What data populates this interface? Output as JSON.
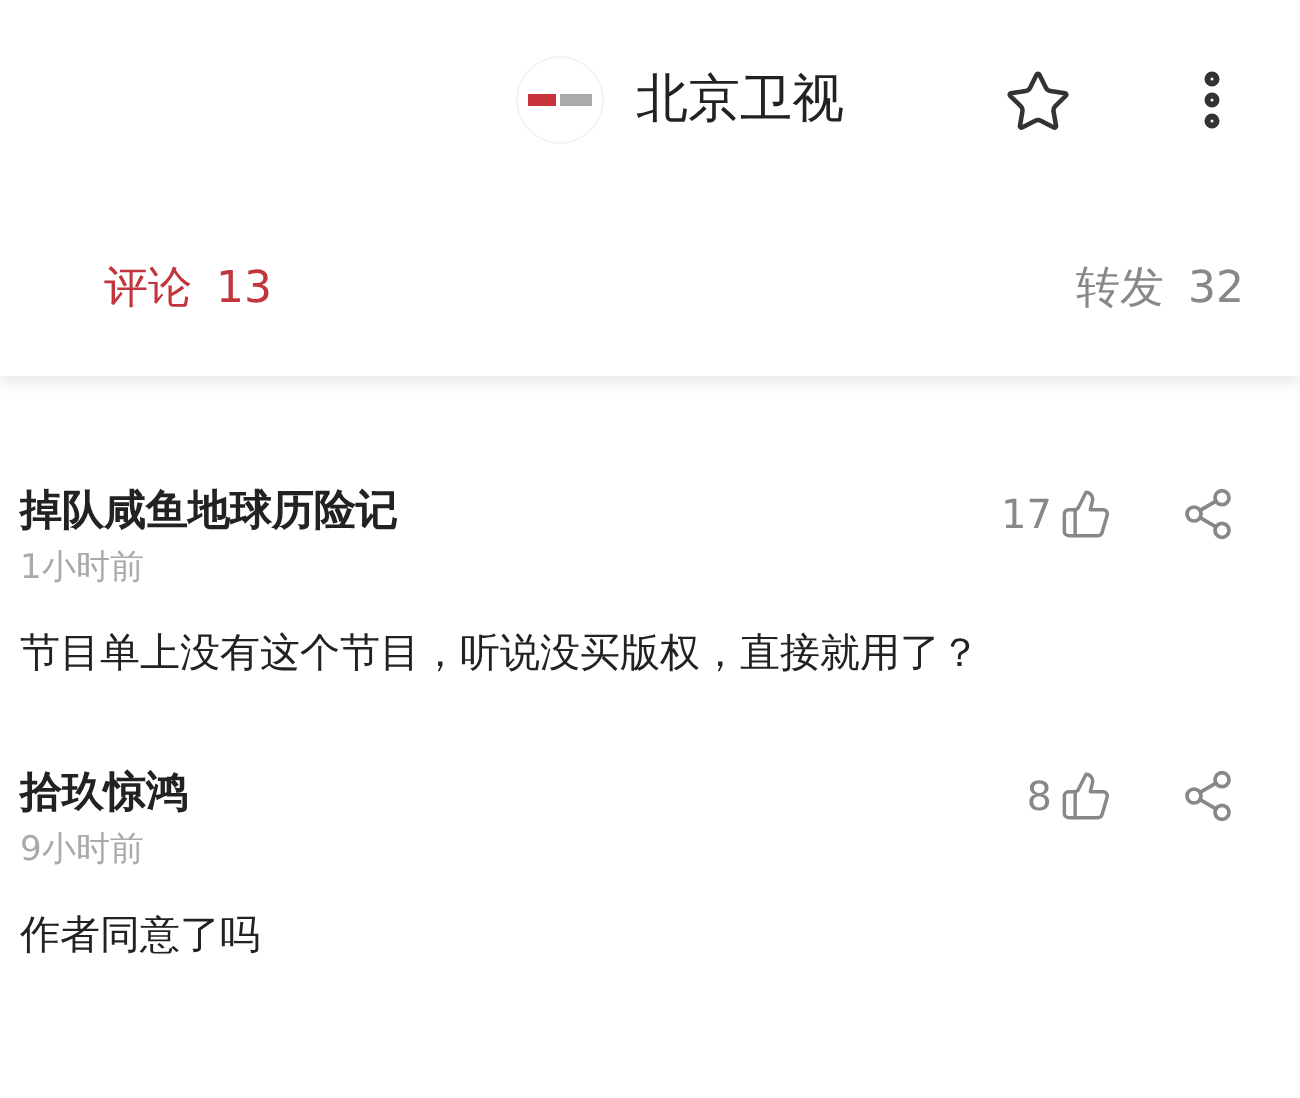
{
  "header": {
    "title": "北京卫视",
    "starred": false
  },
  "tabs": [
    {
      "label": "评论",
      "count": "13",
      "selected": true
    },
    {
      "label": "转发",
      "count": "32",
      "selected": false
    }
  ],
  "comments": [
    {
      "author": "掉队咸鱼地球历险记",
      "time": "1小时前",
      "likes": "17",
      "text": "节目单上没有这个节目，听说没买版权，直接就用了？"
    },
    {
      "author": "拾玖惊鸿",
      "time": "9小时前",
      "likes": "8",
      "text": "作者同意了吗"
    }
  ]
}
